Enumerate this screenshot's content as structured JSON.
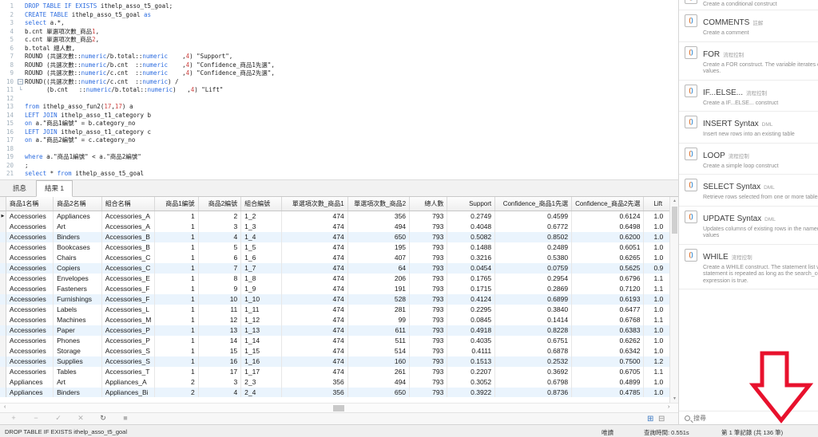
{
  "colors": {
    "keyword_blue": "#2c6ce0",
    "number_red": "#cf4542",
    "arrow_red": "#e8112d",
    "stripe_blue": "#eaf4fd"
  },
  "editor": {
    "lines": [
      {
        "n": 1,
        "fold": "",
        "segs": [
          [
            "kw",
            "DROP TABLE IF EXISTS"
          ],
          [
            "id",
            " ithelp_asso_t5_goal;"
          ]
        ]
      },
      {
        "n": 2,
        "fold": "",
        "segs": [
          [
            "kw",
            "CREATE TABLE"
          ],
          [
            "id",
            " ithelp_asso_t5_goal "
          ],
          [
            "kw",
            "as"
          ]
        ]
      },
      {
        "n": 3,
        "fold": "",
        "segs": [
          [
            "kw",
            "select"
          ],
          [
            "id",
            " a.*,"
          ]
        ]
      },
      {
        "n": 4,
        "fold": "",
        "segs": [
          [
            "id",
            "b.cnt 單選項次數_商品"
          ],
          [
            "num",
            "1"
          ],
          [
            "id",
            ","
          ]
        ]
      },
      {
        "n": 5,
        "fold": "",
        "segs": [
          [
            "id",
            "c.cnt 單選項次數_商品"
          ],
          [
            "num",
            "2"
          ],
          [
            "id",
            ","
          ]
        ]
      },
      {
        "n": 6,
        "fold": "",
        "segs": [
          [
            "id",
            "b.total 總人數,"
          ]
        ]
      },
      {
        "n": 7,
        "fold": "",
        "segs": [
          [
            "id",
            "ROUND (共選次數::"
          ],
          [
            "kw",
            "numeric"
          ],
          [
            "id",
            "/b.total::"
          ],
          [
            "kw",
            "numeric"
          ],
          [
            "id",
            "    ,"
          ],
          [
            "num",
            "4"
          ],
          [
            "id",
            ") \"Support\","
          ]
        ]
      },
      {
        "n": 8,
        "fold": "",
        "segs": [
          [
            "id",
            "ROUND (共選次數::"
          ],
          [
            "kw",
            "numeric"
          ],
          [
            "id",
            "/b.cnt  ::"
          ],
          [
            "kw",
            "numeric"
          ],
          [
            "id",
            "    ,"
          ],
          [
            "num",
            "4"
          ],
          [
            "id",
            ") \"Confidence_商品1先選\","
          ]
        ]
      },
      {
        "n": 9,
        "fold": "",
        "segs": [
          [
            "id",
            "ROUND (共選次數::"
          ],
          [
            "kw",
            "numeric"
          ],
          [
            "id",
            "/c.cnt  ::"
          ],
          [
            "kw",
            "numeric"
          ],
          [
            "id",
            "    ,"
          ],
          [
            "num",
            "4"
          ],
          [
            "id",
            ") \"Confidence_商品2先選\","
          ]
        ]
      },
      {
        "n": 10,
        "fold": "box",
        "segs": [
          [
            "id",
            "ROUND((共選次數::"
          ],
          [
            "kw",
            "numeric"
          ],
          [
            "id",
            "/c.cnt  ::"
          ],
          [
            "kw",
            "numeric"
          ],
          [
            "id",
            ") /"
          ]
        ]
      },
      {
        "n": 11,
        "fold": "corner",
        "segs": [
          [
            "id",
            "      (b.cnt   ::"
          ],
          [
            "kw",
            "numeric"
          ],
          [
            "id",
            "/b.total::"
          ],
          [
            "kw",
            "numeric"
          ],
          [
            "id",
            ")   ,"
          ],
          [
            "num",
            "4"
          ],
          [
            "id",
            ") \"Lift\""
          ]
        ]
      },
      {
        "n": 12,
        "fold": "",
        "segs": []
      },
      {
        "n": 13,
        "fold": "",
        "segs": [
          [
            "kw",
            "from"
          ],
          [
            "id",
            " ithelp_asso_fun2("
          ],
          [
            "num",
            "17"
          ],
          [
            "id",
            ","
          ],
          [
            "num",
            "17"
          ],
          [
            "id",
            ") a"
          ]
        ]
      },
      {
        "n": 14,
        "fold": "",
        "segs": [
          [
            "kw",
            "LEFT JOIN"
          ],
          [
            "id",
            " ithelp_asso_t1_category b"
          ]
        ]
      },
      {
        "n": 15,
        "fold": "",
        "segs": [
          [
            "kw",
            "on"
          ],
          [
            "id",
            " a.\"商品1編號\" = b.category_no"
          ]
        ]
      },
      {
        "n": 16,
        "fold": "",
        "segs": [
          [
            "kw",
            "LEFT JOIN"
          ],
          [
            "id",
            " ithelp_asso_t1_category c"
          ]
        ]
      },
      {
        "n": 17,
        "fold": "",
        "segs": [
          [
            "kw",
            "on"
          ],
          [
            "id",
            " a.\"商品2編號\" = c.category_no"
          ]
        ]
      },
      {
        "n": 18,
        "fold": "",
        "segs": []
      },
      {
        "n": 19,
        "fold": "",
        "segs": [
          [
            "kw",
            "where"
          ],
          [
            "id",
            " a.\"商品1編號\" < a.\"商品2編號\""
          ]
        ]
      },
      {
        "n": 20,
        "fold": "",
        "segs": [
          [
            "id",
            ";"
          ]
        ]
      },
      {
        "n": 21,
        "fold": "",
        "segs": [
          [
            "kw",
            "select"
          ],
          [
            "id",
            " * "
          ],
          [
            "kw",
            "from"
          ],
          [
            "id",
            " ithelp_asso_t5_goal"
          ]
        ]
      }
    ]
  },
  "tabs": {
    "messages": "訊息",
    "result": "結果 1"
  },
  "grid": {
    "columns": [
      {
        "label": "商品1名稱",
        "width": 60,
        "align": "l"
      },
      {
        "label": "商品2名稱",
        "width": 62,
        "align": "l"
      },
      {
        "label": "組合名稱",
        "width": 55,
        "align": "l"
      },
      {
        "label": "商品1編號",
        "width": 56,
        "align": "r"
      },
      {
        "label": "商品2編號",
        "width": 55,
        "align": "r"
      },
      {
        "label": "組合編號",
        "width": 53,
        "align": "l"
      },
      {
        "label": "單選項次數_商品1",
        "width": 84,
        "align": "r"
      },
      {
        "label": "單選項次數_商品2",
        "width": 78,
        "align": "r"
      },
      {
        "label": "總人數",
        "width": 50,
        "align": "r"
      },
      {
        "label": "Support",
        "width": 64,
        "align": "r"
      },
      {
        "label": "Confidence_商品1先選",
        "width": 97,
        "align": "r"
      },
      {
        "label": "Confidence_商品2先選",
        "width": 90,
        "align": "r"
      },
      {
        "label": "Lift",
        "width": 45,
        "align": "lift"
      }
    ],
    "rows": [
      [
        "Accessories",
        "Appliances",
        "Accessories_A",
        "1",
        "2",
        "1_2",
        "474",
        "356",
        "793",
        "0.2749",
        "0.4599",
        "0.6124",
        "1.0"
      ],
      [
        "Accessories",
        "Art",
        "Accessories_A",
        "1",
        "3",
        "1_3",
        "474",
        "494",
        "793",
        "0.4048",
        "0.6772",
        "0.6498",
        "1.0"
      ],
      [
        "Accessories",
        "Binders",
        "Accessories_B",
        "1",
        "4",
        "1_4",
        "474",
        "650",
        "793",
        "0.5082",
        "0.8502",
        "0.6200",
        "1.0"
      ],
      [
        "Accessories",
        "Bookcases",
        "Accessories_B",
        "1",
        "5",
        "1_5",
        "474",
        "195",
        "793",
        "0.1488",
        "0.2489",
        "0.6051",
        "1.0"
      ],
      [
        "Accessories",
        "Chairs",
        "Accessories_C",
        "1",
        "6",
        "1_6",
        "474",
        "407",
        "793",
        "0.3216",
        "0.5380",
        "0.6265",
        "1.0"
      ],
      [
        "Accessories",
        "Copiers",
        "Accessories_C",
        "1",
        "7",
        "1_7",
        "474",
        "64",
        "793",
        "0.0454",
        "0.0759",
        "0.5625",
        "0.9"
      ],
      [
        "Accessories",
        "Envelopes",
        "Accessories_E",
        "1",
        "8",
        "1_8",
        "474",
        "206",
        "793",
        "0.1765",
        "0.2954",
        "0.6796",
        "1.1"
      ],
      [
        "Accessories",
        "Fasteners",
        "Accessories_F",
        "1",
        "9",
        "1_9",
        "474",
        "191",
        "793",
        "0.1715",
        "0.2869",
        "0.7120",
        "1.1"
      ],
      [
        "Accessories",
        "Furnishings",
        "Accessories_F",
        "1",
        "10",
        "1_10",
        "474",
        "528",
        "793",
        "0.4124",
        "0.6899",
        "0.6193",
        "1.0"
      ],
      [
        "Accessories",
        "Labels",
        "Accessories_L",
        "1",
        "11",
        "1_11",
        "474",
        "281",
        "793",
        "0.2295",
        "0.3840",
        "0.6477",
        "1.0"
      ],
      [
        "Accessories",
        "Machines",
        "Accessories_M",
        "1",
        "12",
        "1_12",
        "474",
        "99",
        "793",
        "0.0845",
        "0.1414",
        "0.6768",
        "1.1"
      ],
      [
        "Accessories",
        "Paper",
        "Accessories_P",
        "1",
        "13",
        "1_13",
        "474",
        "611",
        "793",
        "0.4918",
        "0.8228",
        "0.6383",
        "1.0"
      ],
      [
        "Accessories",
        "Phones",
        "Accessories_P",
        "1",
        "14",
        "1_14",
        "474",
        "511",
        "793",
        "0.4035",
        "0.6751",
        "0.6262",
        "1.0"
      ],
      [
        "Accessories",
        "Storage",
        "Accessories_S",
        "1",
        "15",
        "1_15",
        "474",
        "514",
        "793",
        "0.4111",
        "0.6878",
        "0.6342",
        "1.0"
      ],
      [
        "Accessories",
        "Supplies",
        "Accessories_S",
        "1",
        "16",
        "1_16",
        "474",
        "160",
        "793",
        "0.1513",
        "0.2532",
        "0.7500",
        "1.2"
      ],
      [
        "Accessories",
        "Tables",
        "Accessories_T",
        "1",
        "17",
        "1_17",
        "474",
        "261",
        "793",
        "0.2207",
        "0.3692",
        "0.6705",
        "1.1"
      ],
      [
        "Appliances",
        "Art",
        "Appliances_A",
        "2",
        "3",
        "2_3",
        "356",
        "494",
        "793",
        "0.3052",
        "0.6798",
        "0.4899",
        "1.0"
      ],
      [
        "Appliances",
        "Binders",
        "Appliances_Bi",
        "2",
        "4",
        "2_4",
        "356",
        "650",
        "793",
        "0.3922",
        "0.8736",
        "0.4785",
        "1.0"
      ]
    ],
    "row_marker": "▶"
  },
  "grid_toolbar": {
    "icons": [
      {
        "name": "add-record-button",
        "glyph": "+",
        "dark": false
      },
      {
        "name": "delete-record-button",
        "glyph": "−",
        "dark": false
      },
      {
        "name": "apply-changes-button",
        "glyph": "✓",
        "dark": false
      },
      {
        "name": "discard-changes-button",
        "glyph": "✕",
        "dark": false
      },
      {
        "name": "refresh-button",
        "glyph": "↻",
        "dark": true
      },
      {
        "name": "stop-button",
        "glyph": "■",
        "dark": false
      }
    ],
    "view_toggles": [
      {
        "name": "grid-view-toggle",
        "glyph": "⊞",
        "active": true
      },
      {
        "name": "form-view-toggle",
        "glyph": "⊟",
        "active": false
      }
    ]
  },
  "hscroll": {
    "left_arrow": "‹",
    "right_arrow": "›"
  },
  "vscroll": {
    "up_arrow": "▲",
    "down_arrow": "▼"
  },
  "statusbar": {
    "left": "DROP TABLE IF EXISTS ithelp_asso_t5_goal",
    "readonly": "唯讀",
    "query_time": "查詢時間: 0.551s",
    "record": "第 1 筆記錄 (共 136 筆)"
  },
  "sidebar": {
    "partial_top_desc": "Create a conditional construct",
    "icon_left": "(",
    "icon_right": ")",
    "items": [
      {
        "title": "COMMENTS",
        "tag": "註解",
        "desc": "Create a comment"
      },
      {
        "title": "FOR",
        "tag": "流程控制",
        "desc": "Create a FOR construct. The variable iterates over a range of values."
      },
      {
        "title": "IF...ELSE...",
        "tag": "流程控制",
        "desc": "Create a IF...ELSE... construct"
      },
      {
        "title": "INSERT Syntax",
        "tag": "DML",
        "desc": "Insert new rows into an existing table"
      },
      {
        "title": "LOOP",
        "tag": "流程控制",
        "desc": "Create a simple loop construct"
      },
      {
        "title": "SELECT Syntax",
        "tag": "DML",
        "desc": "Retrieve rows selected from one or more tables"
      },
      {
        "title": "UPDATE Syntax",
        "tag": "DML",
        "desc": "Updates columns of existing rows in the named table with new values"
      },
      {
        "title": "WHILE",
        "tag": "流程控制",
        "desc": "Create a WHILE construct. The statement list within a WHILE statement is repeated as long as the search_condition expression is true."
      }
    ],
    "search_placeholder": "搜尋"
  }
}
